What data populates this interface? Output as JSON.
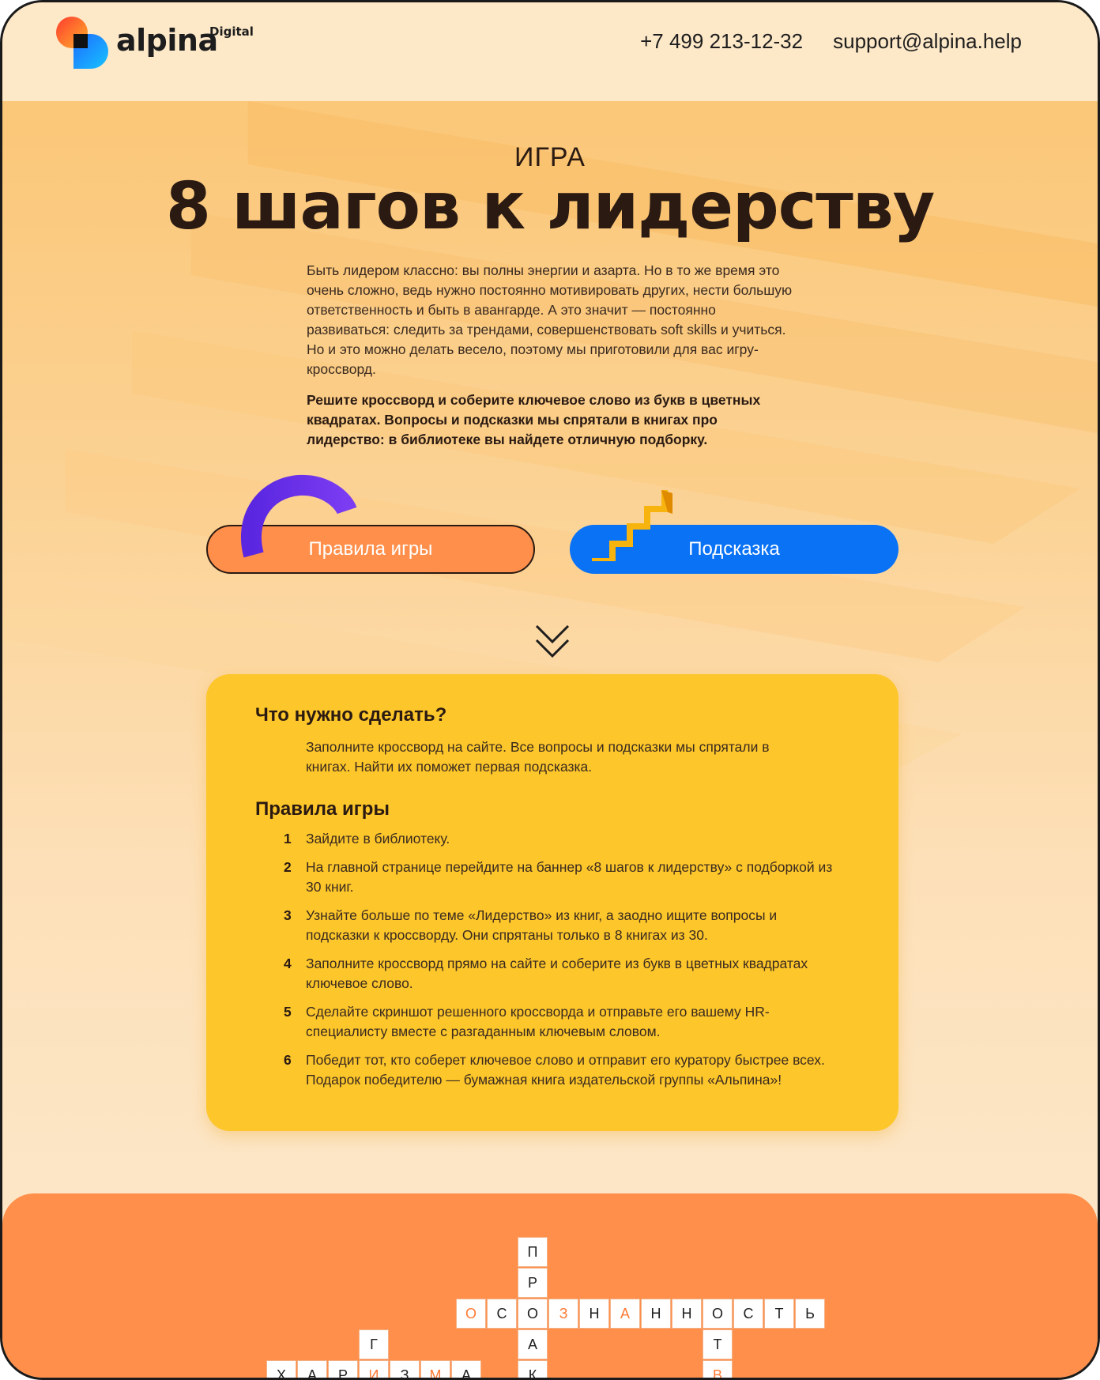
{
  "header": {
    "logo_text": "alpina",
    "logo_sub": "Digital",
    "phone": "+7 499 213-12-32",
    "email": "support@alpina.help"
  },
  "hero": {
    "eyebrow": "ИГРА",
    "title": "8 шагов к лидерству",
    "intro": "Быть лидером классно: вы полны энергии и азарта. Но в то же время это очень сложно, ведь нужно постоянно мотивировать других, нести большую ответственность и быть в авангарде. А это значит — постоянно развиваться: следить за трендами, совершенствовать soft skills и учиться. Но и это можно делать весело, поэтому мы приготовили для вас игру-кроссворд.",
    "intro_bold": "Решите кроссворд и соберите ключевое слово из букв в цветных квадратах. Вопросы и подсказки мы спрятали в книгах про лидерство: в библиотеке вы найдете отличную подборку.",
    "rules_button": "Правила игры",
    "hint_button": "Подсказка"
  },
  "card": {
    "what_title": "Что нужно сделать?",
    "what_text": "Заполните кроссворд на сайте. Все вопросы и подсказки мы спрятали в книгах. Найти их поможет первая подсказка.",
    "rules_title": "Правила игры",
    "rules": [
      {
        "num": "1",
        "text": "Зайдите в библиотеку."
      },
      {
        "num": "2",
        "text": "На главной странице перейдите на баннер «8 шагов к лидерству» с подборкой из 30 книг."
      },
      {
        "num": "3",
        "text": "Узнайте больше по теме «Лидерство» из книг, а заодно ищите вопросы и подсказки к кроссворду. Они спрятаны только в 8 книгах из 30."
      },
      {
        "num": "4",
        "text": "Заполните кроссворд прямо на сайте и соберите из букв в цветных квадратах ключевое слово."
      },
      {
        "num": "5",
        "text": "Сделайте скриншот решенного кроссворда и отправьте его вашему HR-специалисту вместе с разгаданным ключевым словом."
      },
      {
        "num": "6",
        "text": "Победит тот, кто соберет ключевое слово и отправит его куратору быстрее всех. Подарок победителю — бумажная книга издательской группы «Альпина»!"
      }
    ]
  },
  "crossword": {
    "cells": [
      {
        "letter": "П",
        "hl": false
      },
      {
        "letter": "Р",
        "hl": false
      },
      {
        "letter": "О",
        "hl": true
      },
      {
        "letter": "С",
        "hl": false
      },
      {
        "letter": "О",
        "hl": false
      },
      {
        "letter": "З",
        "hl": true
      },
      {
        "letter": "Н",
        "hl": false
      },
      {
        "letter": "А",
        "hl": true
      },
      {
        "letter": "Н",
        "hl": false
      },
      {
        "letter": "Н",
        "hl": false
      },
      {
        "letter": "О",
        "hl": false
      },
      {
        "letter": "С",
        "hl": false
      },
      {
        "letter": "Т",
        "hl": false
      },
      {
        "letter": "Ь",
        "hl": false
      },
      {
        "letter": "А",
        "hl": false
      },
      {
        "letter": "Т",
        "hl": false
      },
      {
        "letter": "Г",
        "hl": false
      },
      {
        "letter": "К",
        "hl": false
      },
      {
        "letter": "В",
        "hl": true
      },
      {
        "letter": "Х",
        "hl": false
      },
      {
        "letter": "А",
        "hl": false
      },
      {
        "letter": "Р",
        "hl": false
      },
      {
        "letter": "И",
        "hl": true
      },
      {
        "letter": "З",
        "hl": false
      },
      {
        "letter": "М",
        "hl": true
      },
      {
        "letter": "А",
        "hl": false
      }
    ]
  },
  "colors": {
    "accent_orange": "#ff8f4a",
    "accent_blue": "#0a72f5",
    "card_yellow": "#fdc62a",
    "arc_purple": "#6d2fe6",
    "stairs_yellow": "#f7b40e"
  },
  "icons": {
    "chevron": "double-chevron-down-icon",
    "logo": "alpina-logo-icon"
  }
}
